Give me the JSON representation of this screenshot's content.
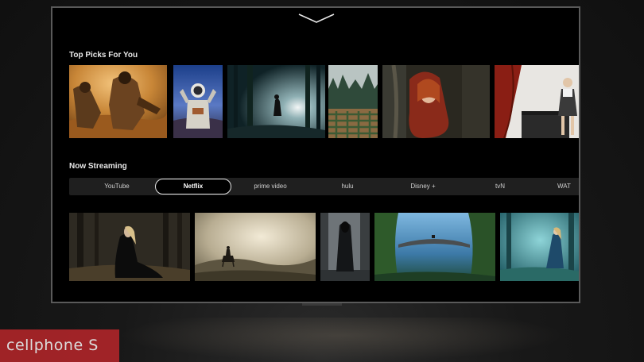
{
  "sections": {
    "top_picks": {
      "title": "Top Picks For You"
    },
    "now_streaming": {
      "title": "Now Streaming"
    }
  },
  "tabs": [
    {
      "label": "YouTube",
      "active": false
    },
    {
      "label": "Netflix",
      "active": true
    },
    {
      "label": "prime video",
      "active": false
    },
    {
      "label": "hulu",
      "active": false
    },
    {
      "label": "Disney +",
      "active": false
    },
    {
      "label": "tvN",
      "active": false
    },
    {
      "label": "WAT",
      "active": false
    }
  ],
  "top_picks": [
    {
      "icon": "desert-adventurers-thumbnail"
    },
    {
      "icon": "astronaut-thumbnail"
    },
    {
      "icon": "foggy-forest-light-thumbnail"
    },
    {
      "icon": "hedge-maze-thumbnail"
    },
    {
      "icon": "red-hood-girl-thumbnail"
    },
    {
      "icon": "piano-girl-thumbnail"
    }
  ],
  "streaming": [
    {
      "icon": "dark-forest-woman-thumbnail"
    },
    {
      "icon": "rider-hills-thumbnail"
    },
    {
      "icon": "cloaked-figure-thumbnail"
    },
    {
      "icon": "stone-bridge-valley-thumbnail"
    },
    {
      "icon": "misty-forest-lady-thumbnail"
    }
  ],
  "watermark": {
    "text": "cellphone S"
  },
  "colors": {
    "screen_bg": "#000000",
    "tab_bar_bg": "#1f1f1f",
    "watermark_red": "#b8262a"
  }
}
